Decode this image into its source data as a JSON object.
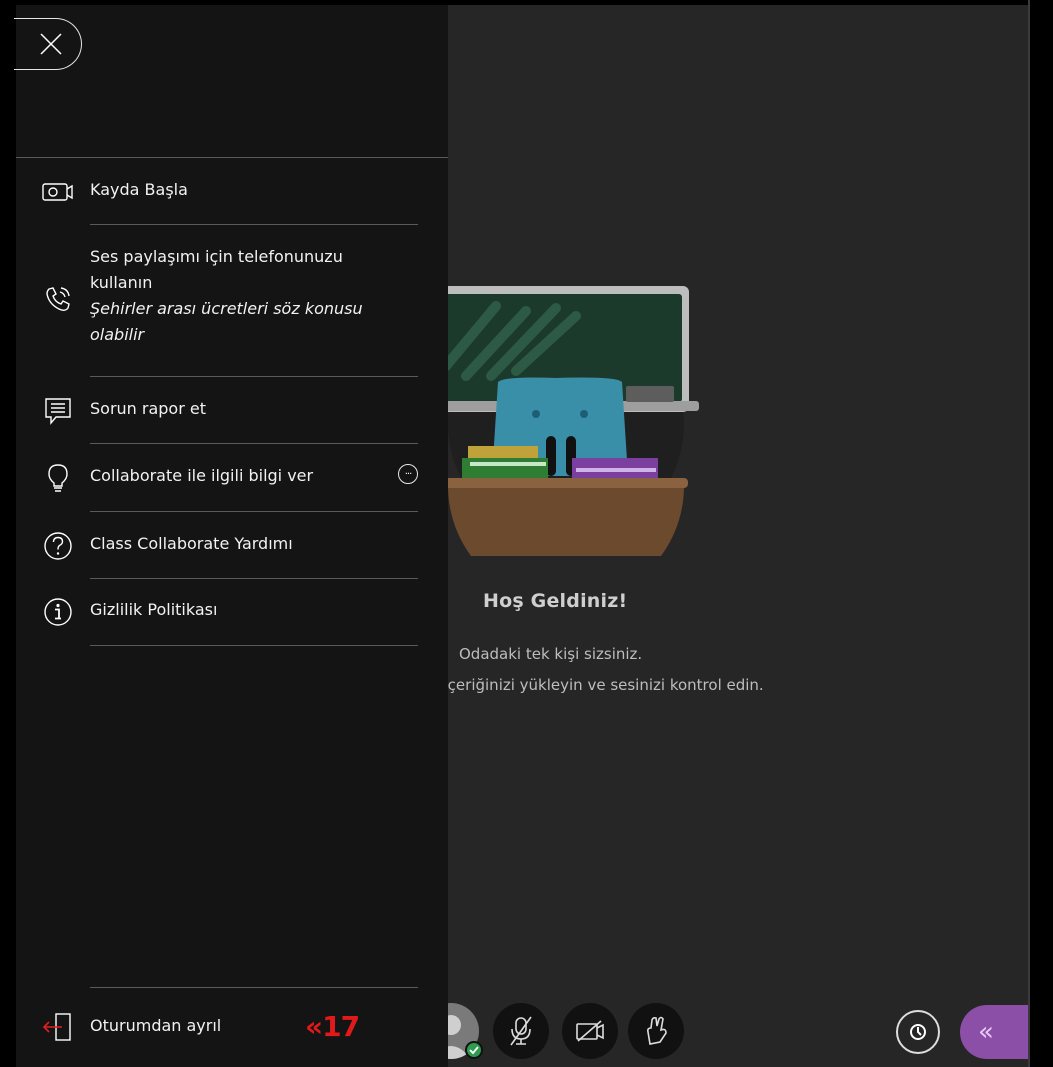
{
  "menu": {
    "items": [
      {
        "label": "Kayda Başla",
        "icon": "video-record-icon"
      },
      {
        "label": "Ses paylaşımı için telefonunuzu kullanın",
        "sublabel": "Şehirler arası ücretleri söz konusu olabilir",
        "icon": "phone-audio-icon"
      },
      {
        "label": "Sorun rapor et",
        "icon": "report-message-icon"
      },
      {
        "label": "Collaborate ile ilgili bilgi ver",
        "icon": "lightbulb-icon"
      },
      {
        "label": "Class Collaborate Yardımı",
        "icon": "help-circle-icon"
      },
      {
        "label": "Gizlilik Politikası",
        "icon": "info-circle-icon"
      }
    ],
    "leave_label": "Oturumdan ayrıl",
    "annotation": "«17"
  },
  "stage": {
    "welcome_title": "Hoş Geldiniz!",
    "welcome_line1": "Odadaki tek kişi sizsiniz.",
    "welcome_line2": "şlayın. İçeriğinizi yükleyin ve sesinizi kontrol edin."
  },
  "colors": {
    "menu_bg": "#141414",
    "stage_bg": "#262626",
    "accent_purple": "#8b4fa8",
    "status_green": "#2e9b4e",
    "annotation_red": "#e01a1a"
  }
}
